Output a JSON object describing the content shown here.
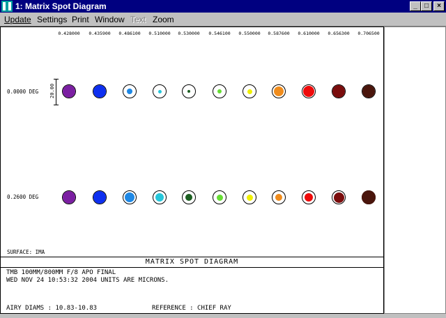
{
  "window": {
    "title": "1: Matrix Spot Diagram",
    "minimize": "_",
    "maximize": "□",
    "close": "×"
  },
  "menu": [
    "Update",
    "Settings",
    "Print",
    "Window",
    "Text",
    "Zoom"
  ],
  "wavelengths": [
    "0.428000",
    "0.435900",
    "0.486100",
    "0.510000",
    "0.530000",
    "0.546100",
    "0.550000",
    "0.587600",
    "0.610000",
    "0.656300",
    "0.706500"
  ],
  "colors": [
    "#7b1fa2",
    "#0d2ff0",
    "#1e88e5",
    "#26c6da",
    "#1b5e20",
    "#66dd33",
    "#f0f000",
    "#f08c1c",
    "#ee0a0a",
    "#7a0c0c",
    "#4a150c"
  ],
  "fields": [
    {
      "label": "0.0000 DEG",
      "dot_sizes": [
        9,
        9,
        4,
        2.5,
        2,
        3,
        3.5,
        7,
        8,
        9,
        9
      ]
    },
    {
      "label": "0.2600 DEG",
      "dot_sizes": [
        9,
        9,
        7,
        6,
        5,
        4.5,
        4.5,
        5,
        6,
        7.5,
        10
      ]
    }
  ],
  "scale_label": "20.00",
  "surface": "SURFACE: IMA",
  "diagram_title": "MATRIX SPOT DIAGRAM",
  "info": {
    "line1": "TMB 100MM/800MM F/8 APO FINAL",
    "line2": "WED NOV 24 10:53:32 2004  UNITS ARE MICRONS.",
    "airy": "AIRY DIAMS : 10.83-10.83",
    "reference": "REFERENCE  : CHIEF RAY"
  }
}
